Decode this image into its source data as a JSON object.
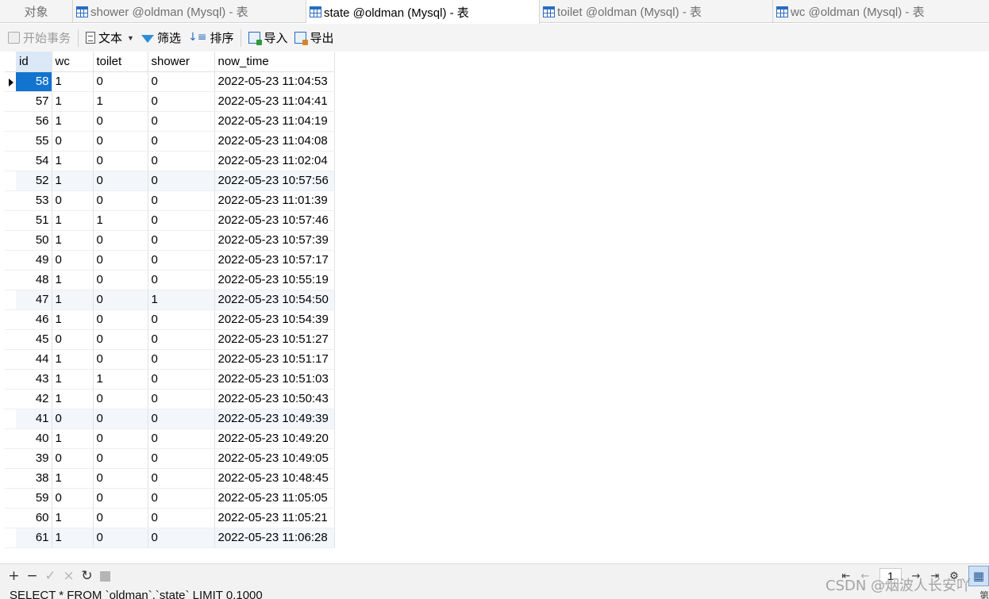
{
  "tabs": [
    {
      "label": "对象"
    },
    {
      "label": "shower @oldman (Mysql) - 表"
    },
    {
      "label": "state @oldman (Mysql) - 表"
    },
    {
      "label": "toilet @oldman (Mysql) - 表"
    },
    {
      "label": "wc @oldman (Mysql) - 表"
    }
  ],
  "toolbar": {
    "begin_transaction": "开始事务",
    "text": "文本",
    "filter": "筛选",
    "sort": "排序",
    "import": "导入",
    "export": "导出"
  },
  "grid": {
    "columns": [
      "id",
      "wc",
      "toilet",
      "shower",
      "now_time"
    ],
    "rows": [
      [
        "58",
        "1",
        "0",
        "0",
        "2022-05-23 11:04:53"
      ],
      [
        "57",
        "1",
        "1",
        "0",
        "2022-05-23 11:04:41"
      ],
      [
        "56",
        "1",
        "0",
        "0",
        "2022-05-23 11:04:19"
      ],
      [
        "55",
        "0",
        "0",
        "0",
        "2022-05-23 11:04:08"
      ],
      [
        "54",
        "1",
        "0",
        "0",
        "2022-05-23 11:02:04"
      ],
      [
        "52",
        "1",
        "0",
        "0",
        "2022-05-23 10:57:56"
      ],
      [
        "53",
        "0",
        "0",
        "0",
        "2022-05-23 11:01:39"
      ],
      [
        "51",
        "1",
        "1",
        "0",
        "2022-05-23 10:57:46"
      ],
      [
        "50",
        "1",
        "0",
        "0",
        "2022-05-23 10:57:39"
      ],
      [
        "49",
        "0",
        "0",
        "0",
        "2022-05-23 10:57:17"
      ],
      [
        "48",
        "1",
        "0",
        "0",
        "2022-05-23 10:55:19"
      ],
      [
        "47",
        "1",
        "0",
        "1",
        "2022-05-23 10:54:50"
      ],
      [
        "46",
        "1",
        "0",
        "0",
        "2022-05-23 10:54:39"
      ],
      [
        "45",
        "0",
        "0",
        "0",
        "2022-05-23 10:51:27"
      ],
      [
        "44",
        "1",
        "0",
        "0",
        "2022-05-23 10:51:17"
      ],
      [
        "43",
        "1",
        "1",
        "0",
        "2022-05-23 10:51:03"
      ],
      [
        "42",
        "1",
        "0",
        "0",
        "2022-05-23 10:50:43"
      ],
      [
        "41",
        "0",
        "0",
        "0",
        "2022-05-23 10:49:39"
      ],
      [
        "40",
        "1",
        "0",
        "0",
        "2022-05-23 10:49:20"
      ],
      [
        "39",
        "0",
        "0",
        "0",
        "2022-05-23 10:49:05"
      ],
      [
        "38",
        "1",
        "0",
        "0",
        "2022-05-23 10:48:45"
      ],
      [
        "59",
        "0",
        "0",
        "0",
        "2022-05-23 11:05:05"
      ],
      [
        "60",
        "1",
        "0",
        "0",
        "2022-05-23 11:05:21"
      ],
      [
        "61",
        "1",
        "0",
        "0",
        "2022-05-23 11:06:28"
      ]
    ],
    "alt_rows": [
      5,
      11,
      17,
      23
    ]
  },
  "pager": {
    "page": "1"
  },
  "status": {
    "sql": "SELECT * FROM `oldman`.`state` LIMIT 0,1000",
    "corner": "第"
  },
  "watermark": "CSDN @烟波人长安吖",
  "colors": {
    "selection": "#1274cf",
    "header_highlight": "#dbe8f8",
    "accent": "#2a6cc0"
  }
}
